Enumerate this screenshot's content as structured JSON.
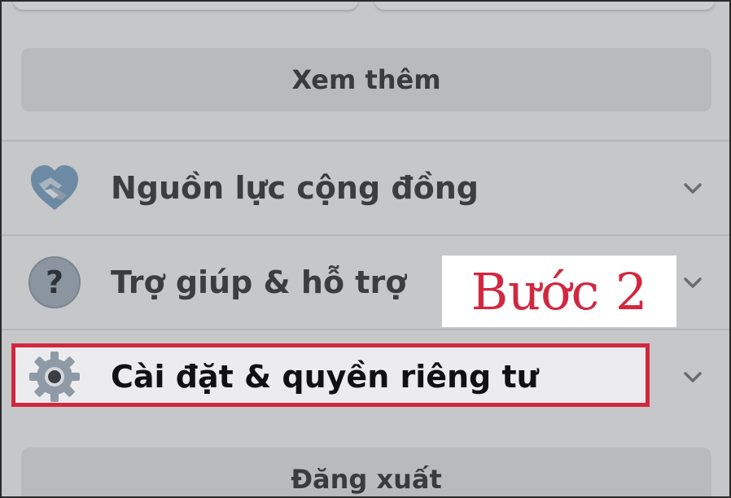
{
  "menu": {
    "see_more_label": "Xem thêm",
    "items": [
      {
        "label": "Nguồn lực cộng đồng",
        "icon": "handshake-icon"
      },
      {
        "label": "Trợ giúp & hỗ trợ",
        "icon": "question-mark-icon"
      },
      {
        "label": "Cài đặt & quyền riêng tư",
        "icon": "gear-icon"
      }
    ],
    "logout_label": "Đăng xuất"
  },
  "annotation": {
    "step_label": "Bước 2",
    "color": "#d12840"
  },
  "colors": {
    "overlay_background": "#c6c7c9",
    "highlight_background": "#ececee",
    "highlight_border": "#d12840"
  }
}
